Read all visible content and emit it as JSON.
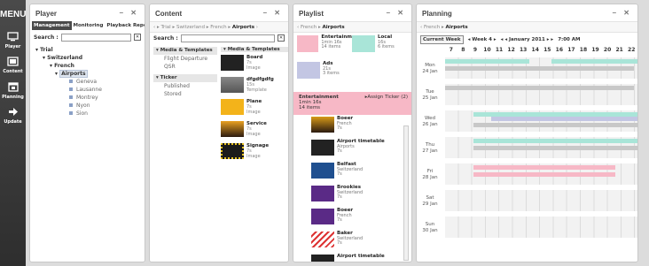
{
  "menu": {
    "title": "MENU",
    "items": [
      {
        "label": "Player",
        "icon": "monitor-icon"
      },
      {
        "label": "Content",
        "icon": "film-icon"
      },
      {
        "label": "Planning",
        "icon": "calendar-icon"
      },
      {
        "label": "Update",
        "icon": "arrow-right-icon"
      }
    ]
  },
  "player": {
    "title": "Player",
    "controls": "– ✕",
    "tabs": [
      "Management",
      "Monitoring",
      "Playback Reporting"
    ],
    "search_label": "Search :",
    "search_clear": "✕",
    "tree": {
      "l1": "Trial",
      "l2": "Switzerland",
      "l3": "French",
      "l4": "Airports",
      "leaves": [
        "Geneva",
        "Lausanne",
        "Montrey",
        "Nyon",
        "Sion"
      ]
    }
  },
  "content": {
    "title": "Content",
    "controls": "– ✕",
    "crumbs": {
      "prefix": "‹ ▸ Trial ▸ Switzerland ▸ French ▸",
      "current": "Airports",
      "suffix": "›"
    },
    "search_label": "Search :",
    "search_clear": "✕",
    "col1": {
      "h1": "Media & Templates",
      "items1": [
        "Flight Departure",
        "QSR"
      ],
      "h2": "Ticker",
      "items2": [
        "Published",
        "Stored"
      ]
    },
    "col2": {
      "header": "Media & Templates",
      "media": [
        {
          "name": "Board",
          "l1": "7s",
          "l2": "Image"
        },
        {
          "name": "dfgdfgdfg",
          "l1": "15s",
          "l2": "Template"
        },
        {
          "name": "Plane",
          "l1": "7s",
          "l2": "Image"
        },
        {
          "name": "Service",
          "l1": "7s",
          "l2": "Image"
        },
        {
          "name": "Signage",
          "l1": "7s",
          "l2": "Image"
        }
      ]
    }
  },
  "playlist": {
    "title": "Playlist",
    "controls": "– ✕",
    "crumbs": {
      "prefix": "‹ French ▸",
      "current": "Airports"
    },
    "tiles": [
      {
        "name": "Entertainm",
        "l1": "1min 16s",
        "l2": "14 items",
        "color": "#f7b8c6"
      },
      {
        "name": "Local",
        "l1": "16s",
        "l2": "6 items",
        "color": "#a9e5d8"
      },
      {
        "name": "Ads",
        "l1": "21s",
        "l2": "3 items",
        "color": "#c3c6e3"
      }
    ],
    "selected": {
      "name": "Entertainment",
      "l1": "1min 16s",
      "l2": "14 items",
      "assign": "▸Assign Ticker (2)"
    },
    "items": [
      {
        "name": "Boeer",
        "l1": "French",
        "l2": "7s"
      },
      {
        "name": "Airport timetable",
        "l1": "Airports",
        "l2": "7s"
      },
      {
        "name": "Belfast",
        "l1": "Switzerland",
        "l2": "7s"
      },
      {
        "name": "Brookies",
        "l1": "Switzerland",
        "l2": "7s"
      },
      {
        "name": "Boeer",
        "l1": "French",
        "l2": "7s"
      },
      {
        "name": "Baker",
        "l1": "Switzerland",
        "l2": "7s"
      },
      {
        "name": "Airport timetable",
        "l1": "",
        "l2": ""
      }
    ]
  },
  "planning": {
    "title": "Planning",
    "controls": "– ✕",
    "crumbs": {
      "prefix": "‹ French ▸",
      "current": "Airports"
    },
    "current_week": "Current Week",
    "week": "◂ Week 4 ▸",
    "month": "◂ ◂ January 2011 ▸ ▸",
    "time": "7:00 AM",
    "hours": [
      "7",
      "8",
      "9",
      "10",
      "11",
      "12",
      "13",
      "14",
      "15",
      "16",
      "17",
      "18",
      "19",
      "20",
      "21",
      "22"
    ],
    "days": [
      {
        "d": "Mon",
        "date": "24 Jan"
      },
      {
        "d": "Tue",
        "date": "25 Jan"
      },
      {
        "d": "Wed",
        "date": "26 Jan"
      },
      {
        "d": "Thu",
        "date": "27 Jan"
      },
      {
        "d": "Fri",
        "date": "28 Jan"
      },
      {
        "d": "Sat",
        "date": "29 Jan"
      },
      {
        "d": "Sun",
        "date": "30 Jan"
      }
    ],
    "colors": {
      "local": "#a9e5d8",
      "ads": "#c3c6e3",
      "entertainment": "#f7b8c6",
      "gray": "#c8c8c8"
    }
  }
}
